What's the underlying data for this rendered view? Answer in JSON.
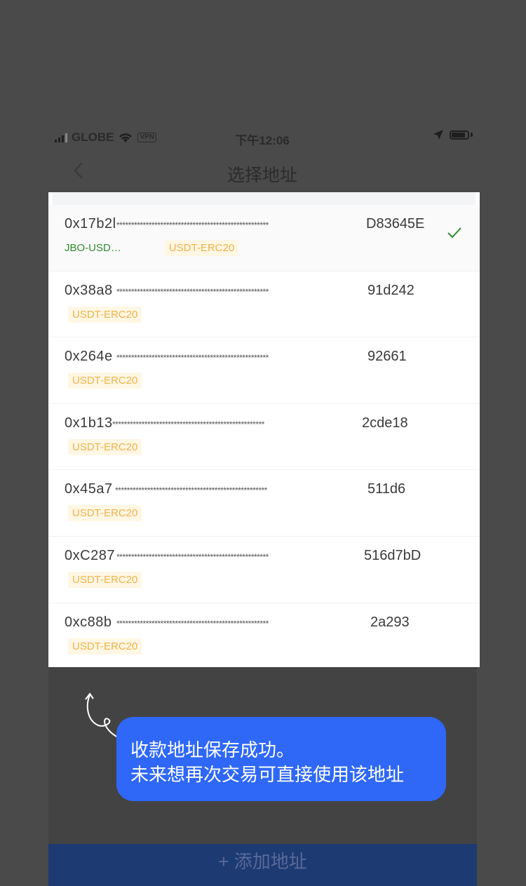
{
  "status_bar": {
    "carrier": "GLOBE",
    "vpn": "VPN",
    "time": "下午12:06"
  },
  "nav": {
    "title": "选择地址"
  },
  "addresses": [
    {
      "prefix": "0x17b2l",
      "mask": "****************************************************",
      "suffix": "D83645E",
      "name": "JBO-USD…",
      "tag": "USDT-ERC20",
      "selected": true
    },
    {
      "prefix": "0x38a8",
      "mask": "****************************************************",
      "suffix": "91d242",
      "name": "",
      "tag": "USDT-ERC20",
      "selected": false
    },
    {
      "prefix": "0x264e",
      "mask": "****************************************************",
      "suffix": "92661",
      "name": "",
      "tag": "USDT-ERC20",
      "selected": false
    },
    {
      "prefix": "0x1b13",
      "mask": "****************************************************",
      "suffix": "2cde18",
      "name": "",
      "tag": "USDT-ERC20",
      "selected": false
    },
    {
      "prefix": "0x45a7",
      "mask": "****************************************************",
      "suffix": "511d6",
      "name": "",
      "tag": "USDT-ERC20",
      "selected": false
    },
    {
      "prefix": "0xC287",
      "mask": "****************************************************",
      "suffix": "516d7bD",
      "name": "",
      "tag": "USDT-ERC20",
      "selected": false
    },
    {
      "prefix": "0xc88b",
      "mask": "****************************************************",
      "suffix": "2a293",
      "name": "",
      "tag": "USDT-ERC20",
      "selected": false
    }
  ],
  "tooltip": {
    "line1": "收款地址保存成功。",
    "line2": "未来想再次交易可直接使用该地址"
  },
  "bottom": {
    "add_label": "+ 添加地址"
  },
  "colors": {
    "accent_blue": "#2f68f6",
    "tag_orange": "#f0b14a",
    "name_green": "#2e8b2e",
    "overlay": "#4a4a4a"
  }
}
